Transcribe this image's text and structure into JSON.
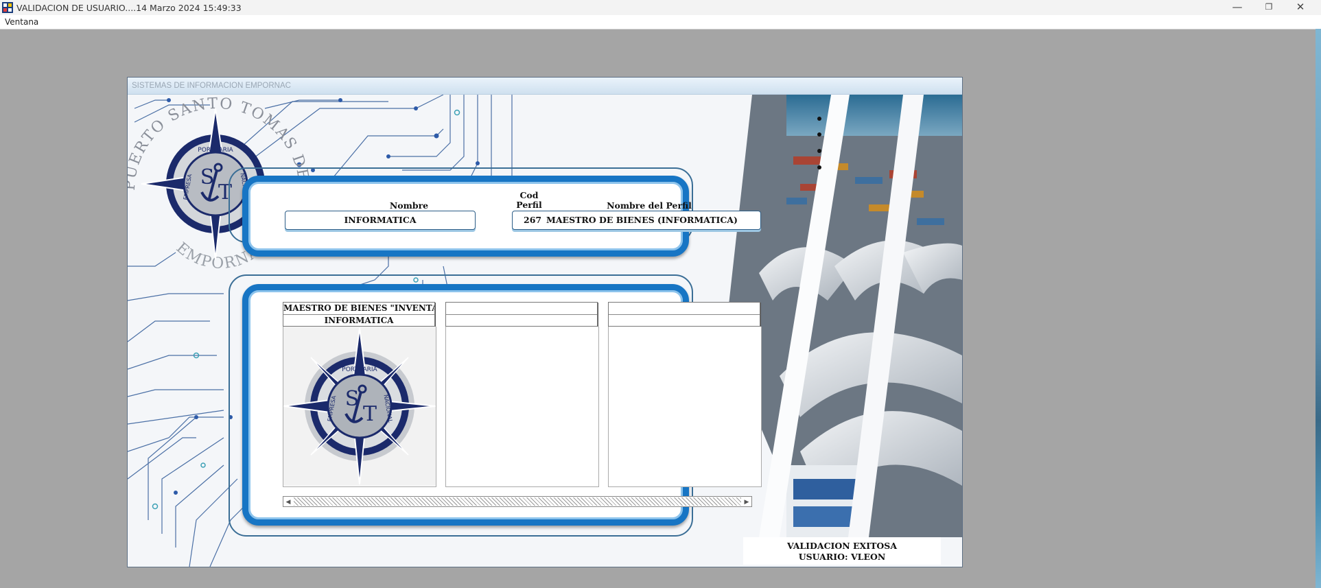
{
  "window": {
    "title": "VALIDACION DE USUARIO....14 Marzo 2024 15:49:33",
    "minimize": "—",
    "maximize": "❐",
    "close": "✕"
  },
  "menu": {
    "items": [
      "Ventana"
    ]
  },
  "child_window": {
    "title": "SISTEMAS DE INFORMACION EMPORNAC"
  },
  "logo": {
    "arc_text_top": "PUERTO SANTO TOMAS DE CASTILLA",
    "arc_text_bottom": "EMPORNAC",
    "ring_portuaria": "PORTUARIA",
    "ring_empresa": "EMPRESA",
    "ring_nacional": "NACIONAL",
    "letter_s": "S",
    "letter_t": "T"
  },
  "user_panel": {
    "nombre_label": "Nombre",
    "nombre_value": "INFORMATICA",
    "cod_perfil_label_1": "Cod",
    "cod_perfil_label_2": "Perfil",
    "perfil_label": "Nombre del Perfil",
    "perfil_code": "267",
    "perfil_value": "MAESTRO DE BIENES (INFORMATICA)"
  },
  "systems_panel": {
    "columns": [
      {
        "line1": "MAESTRO DE BIENES \"INVENTARIOS\"",
        "line2": "INFORMATICA"
      },
      {
        "line1": "",
        "line2": ""
      },
      {
        "line1": "",
        "line2": ""
      }
    ],
    "scroll_left": "◀",
    "scroll_right": "▶"
  },
  "status": {
    "line1": "VALIDACION EXITOSA",
    "line2": "USUARIO: VLEON"
  },
  "colors": {
    "panel_border": "#1775c4",
    "logo_navy": "#1b2a6b",
    "desktop": "#a5a5a5"
  }
}
